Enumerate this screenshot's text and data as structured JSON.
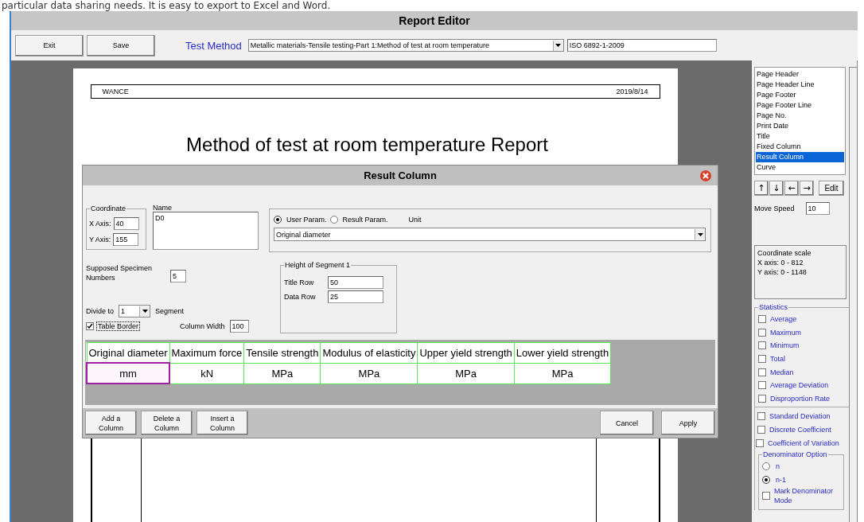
{
  "caption": "particular data sharing needs. It is easy to export to Excel and Word.",
  "window": {
    "title": "Report Editor"
  },
  "toolbar": {
    "buttons": [
      "Exit",
      "Save"
    ],
    "method_label": "Test Method",
    "method_value": "Metallic materials-Tensile testing-Part 1:Method of test at room temperature",
    "standard": "ISO 6892-1-2009"
  },
  "page": {
    "header_left": "WANCE",
    "header_right": "2019/8/14",
    "title": "Method of test at room temperature Report"
  },
  "dialog": {
    "title": "Result Column",
    "coordinate": {
      "legend": "Coordinate",
      "x_label": "X Axis:",
      "x_value": "40",
      "y_label": "Y Axis:",
      "y_value": "155"
    },
    "name": {
      "label": "Name",
      "value": "D0"
    },
    "param_options": [
      {
        "label": "User Param.",
        "selected": true
      },
      {
        "label": "Result Param.",
        "selected": false
      }
    ],
    "unit_label": "Unit",
    "param_value": "Original diameter",
    "specimen": {
      "label": "Supposed Specimen Numbers",
      "value": "5"
    },
    "divide": {
      "label": "Divide to",
      "value": "1",
      "suffix": "Segment"
    },
    "table_border": {
      "label": "Table Border",
      "checked": true
    },
    "column_width": {
      "label": "Column Width",
      "value": "100"
    },
    "segment": {
      "legend": "Height of Segment 1",
      "rows": [
        {
          "label": "Title Row",
          "value": "50"
        },
        {
          "label": "Data Row",
          "value": "25"
        }
      ]
    },
    "columns": [
      {
        "title": "Original diameter",
        "unit": "mm",
        "selected": true
      },
      {
        "title": "Maximum force",
        "unit": "kN",
        "selected": false
      },
      {
        "title": "Tensile strength",
        "unit": "MPa",
        "selected": false
      },
      {
        "title": "Modulus of elasticity",
        "unit": "MPa",
        "selected": false
      },
      {
        "title": "Upper yield strength",
        "unit": "MPa",
        "selected": false
      },
      {
        "title": "Lower yield strength",
        "unit": "MPa",
        "selected": false
      }
    ],
    "buttons_left": [
      "Add a Column",
      "Delete a Column",
      "Insert a Column"
    ],
    "buttons_right": [
      "Cancel",
      "Apply"
    ]
  },
  "sidebar": {
    "items": [
      {
        "label": "Page Header",
        "selected": false
      },
      {
        "label": "Page Header Line",
        "selected": false
      },
      {
        "label": "Page Footer",
        "selected": false
      },
      {
        "label": "Page Footer Line",
        "selected": false
      },
      {
        "label": "Page No.",
        "selected": false
      },
      {
        "label": "Print Date",
        "selected": false
      },
      {
        "label": "Title",
        "selected": false
      },
      {
        "label": "Fixed Column",
        "selected": false
      },
      {
        "label": "Result Column",
        "selected": true
      },
      {
        "label": "Curve",
        "selected": false
      }
    ],
    "arrows": [
      "↑",
      "↓",
      "←",
      "→"
    ],
    "edit": "Edit",
    "move_speed": {
      "label": "Move Speed",
      "value": "10"
    },
    "coordinate_scale": [
      "Coordinate scale",
      "X axis: 0 - 812",
      "Y axis: 0 - 1148"
    ],
    "statistics": {
      "legend": "Statistics",
      "items": [
        {
          "label": "Average",
          "checked": false
        },
        {
          "label": "Maximum",
          "checked": false
        },
        {
          "label": "Minimum",
          "checked": false
        },
        {
          "label": "Total",
          "checked": false
        },
        {
          "label": "Median",
          "checked": false
        },
        {
          "label": "Average Deviation",
          "checked": false
        },
        {
          "label": "Disproportion Rate",
          "checked": false
        }
      ],
      "items2": [
        {
          "label": "Standard Deviation",
          "checked": false
        },
        {
          "label": "Discrete Coefficient",
          "checked": false
        },
        {
          "label": "Coefficient of Variation",
          "checked": false
        }
      ]
    },
    "denominator": {
      "legend": "Denominator Option",
      "options": [
        {
          "label": "n",
          "selected": false
        },
        {
          "label": "n-1",
          "selected": true
        }
      ],
      "mark": {
        "label": "Mark Denominator Mode",
        "checked": false
      }
    }
  }
}
